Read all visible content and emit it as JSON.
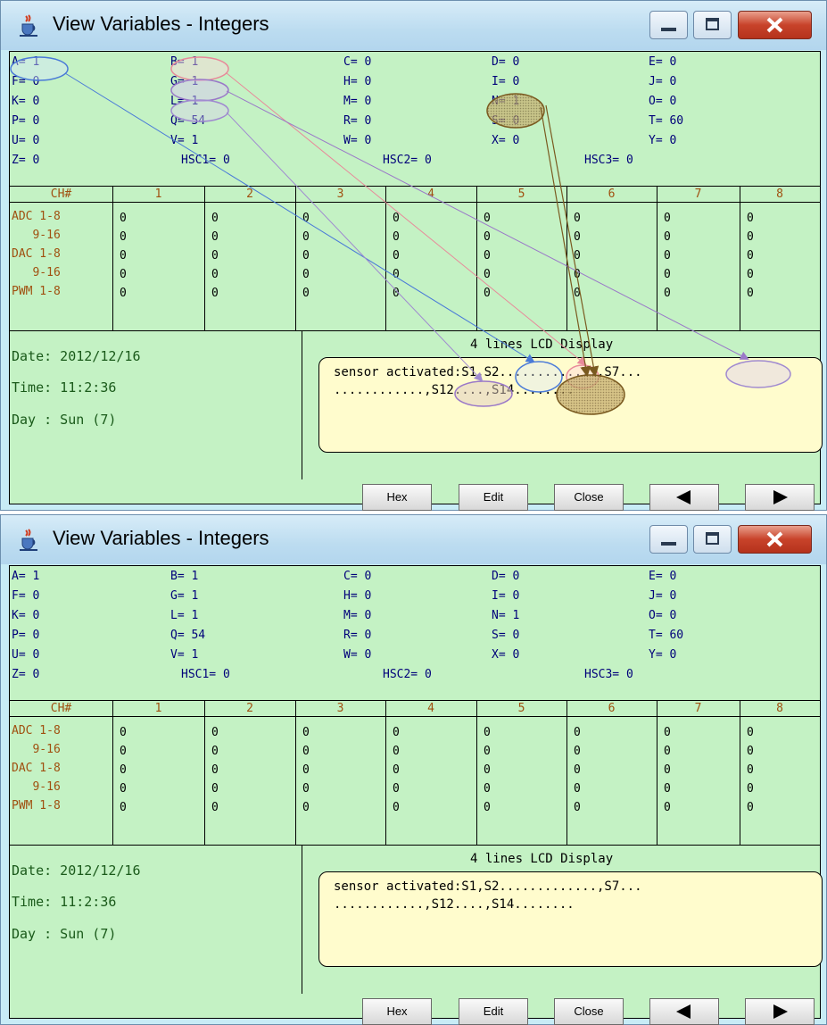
{
  "window": {
    "title": "View Variables - Integers"
  },
  "variables": [
    {
      "label": "A=",
      "value": "1"
    },
    {
      "label": "B=",
      "value": "1"
    },
    {
      "label": "C=",
      "value": "0"
    },
    {
      "label": "D=",
      "value": "0"
    },
    {
      "label": "E=",
      "value": "0"
    },
    {
      "label": "F=",
      "value": "0"
    },
    {
      "label": "G=",
      "value": "1"
    },
    {
      "label": "H=",
      "value": "0"
    },
    {
      "label": "I=",
      "value": "0"
    },
    {
      "label": "J=",
      "value": "0"
    },
    {
      "label": "K=",
      "value": "0"
    },
    {
      "label": "L=",
      "value": "1"
    },
    {
      "label": "M=",
      "value": "0"
    },
    {
      "label": "N=",
      "value": "1"
    },
    {
      "label": "O=",
      "value": "0"
    },
    {
      "label": "P=",
      "value": "0"
    },
    {
      "label": "Q=",
      "value": "54"
    },
    {
      "label": "R=",
      "value": "0"
    },
    {
      "label": "S=",
      "value": "0"
    },
    {
      "label": "T=",
      "value": "60"
    },
    {
      "label": "U=",
      "value": "0"
    },
    {
      "label": "V=",
      "value": "1"
    },
    {
      "label": "W=",
      "value": "0"
    },
    {
      "label": "X=",
      "value": "0"
    },
    {
      "label": "Y=",
      "value": "0"
    },
    {
      "label": "Z=",
      "value": "0"
    }
  ],
  "hsc": [
    {
      "label": "HSC1=",
      "value": "0"
    },
    {
      "label": "HSC2=",
      "value": "0"
    },
    {
      "label": "HSC3=",
      "value": "0"
    }
  ],
  "grid": {
    "header": [
      "CH#",
      "1",
      "2",
      "3",
      "4",
      "5",
      "6",
      "7",
      "8"
    ],
    "rows": [
      {
        "label": "ADC 1-8",
        "cells": [
          "0",
          "0",
          "0",
          "0",
          "0",
          "0",
          "0",
          "0"
        ]
      },
      {
        "label": "   9-16",
        "cells": [
          "0",
          "0",
          "0",
          "0",
          "0",
          "0",
          "0",
          "0"
        ]
      },
      {
        "label": "DAC 1-8",
        "cells": [
          "0",
          "0",
          "0",
          "0",
          "0",
          "0",
          "0",
          "0"
        ]
      },
      {
        "label": "   9-16",
        "cells": [
          "0",
          "0",
          "0",
          "0",
          "0",
          "0",
          "0",
          "0"
        ]
      },
      {
        "label": "PWM 1-8",
        "cells": [
          "0",
          "0",
          "0",
          "0",
          "0",
          "0",
          "0",
          "0"
        ]
      }
    ]
  },
  "info": {
    "date": "Date: 2012/12/16",
    "time": "Time: 11:2:36",
    "day": "Day : Sun (7)"
  },
  "lcd": {
    "title": "4 lines LCD Display",
    "line1": "sensor activated:S1,S2.............,S7...",
    "line2": "............,S12....,S14........"
  },
  "buttons": {
    "hex": "Hex",
    "edit": "Edit",
    "close": "Close"
  },
  "icons": {
    "app": "java-cup-icon",
    "minimize": "minimize-icon",
    "maximize": "maximize-icon",
    "close": "close-icon",
    "prev": "arrow-left-icon",
    "next": "arrow-right-icon"
  },
  "colors": {
    "panel": "#c4f2c4",
    "lcd_bg": "#fffccd",
    "close_btn": "#c8432a",
    "var_text": "#00007a",
    "channel_text": "#a05010"
  }
}
